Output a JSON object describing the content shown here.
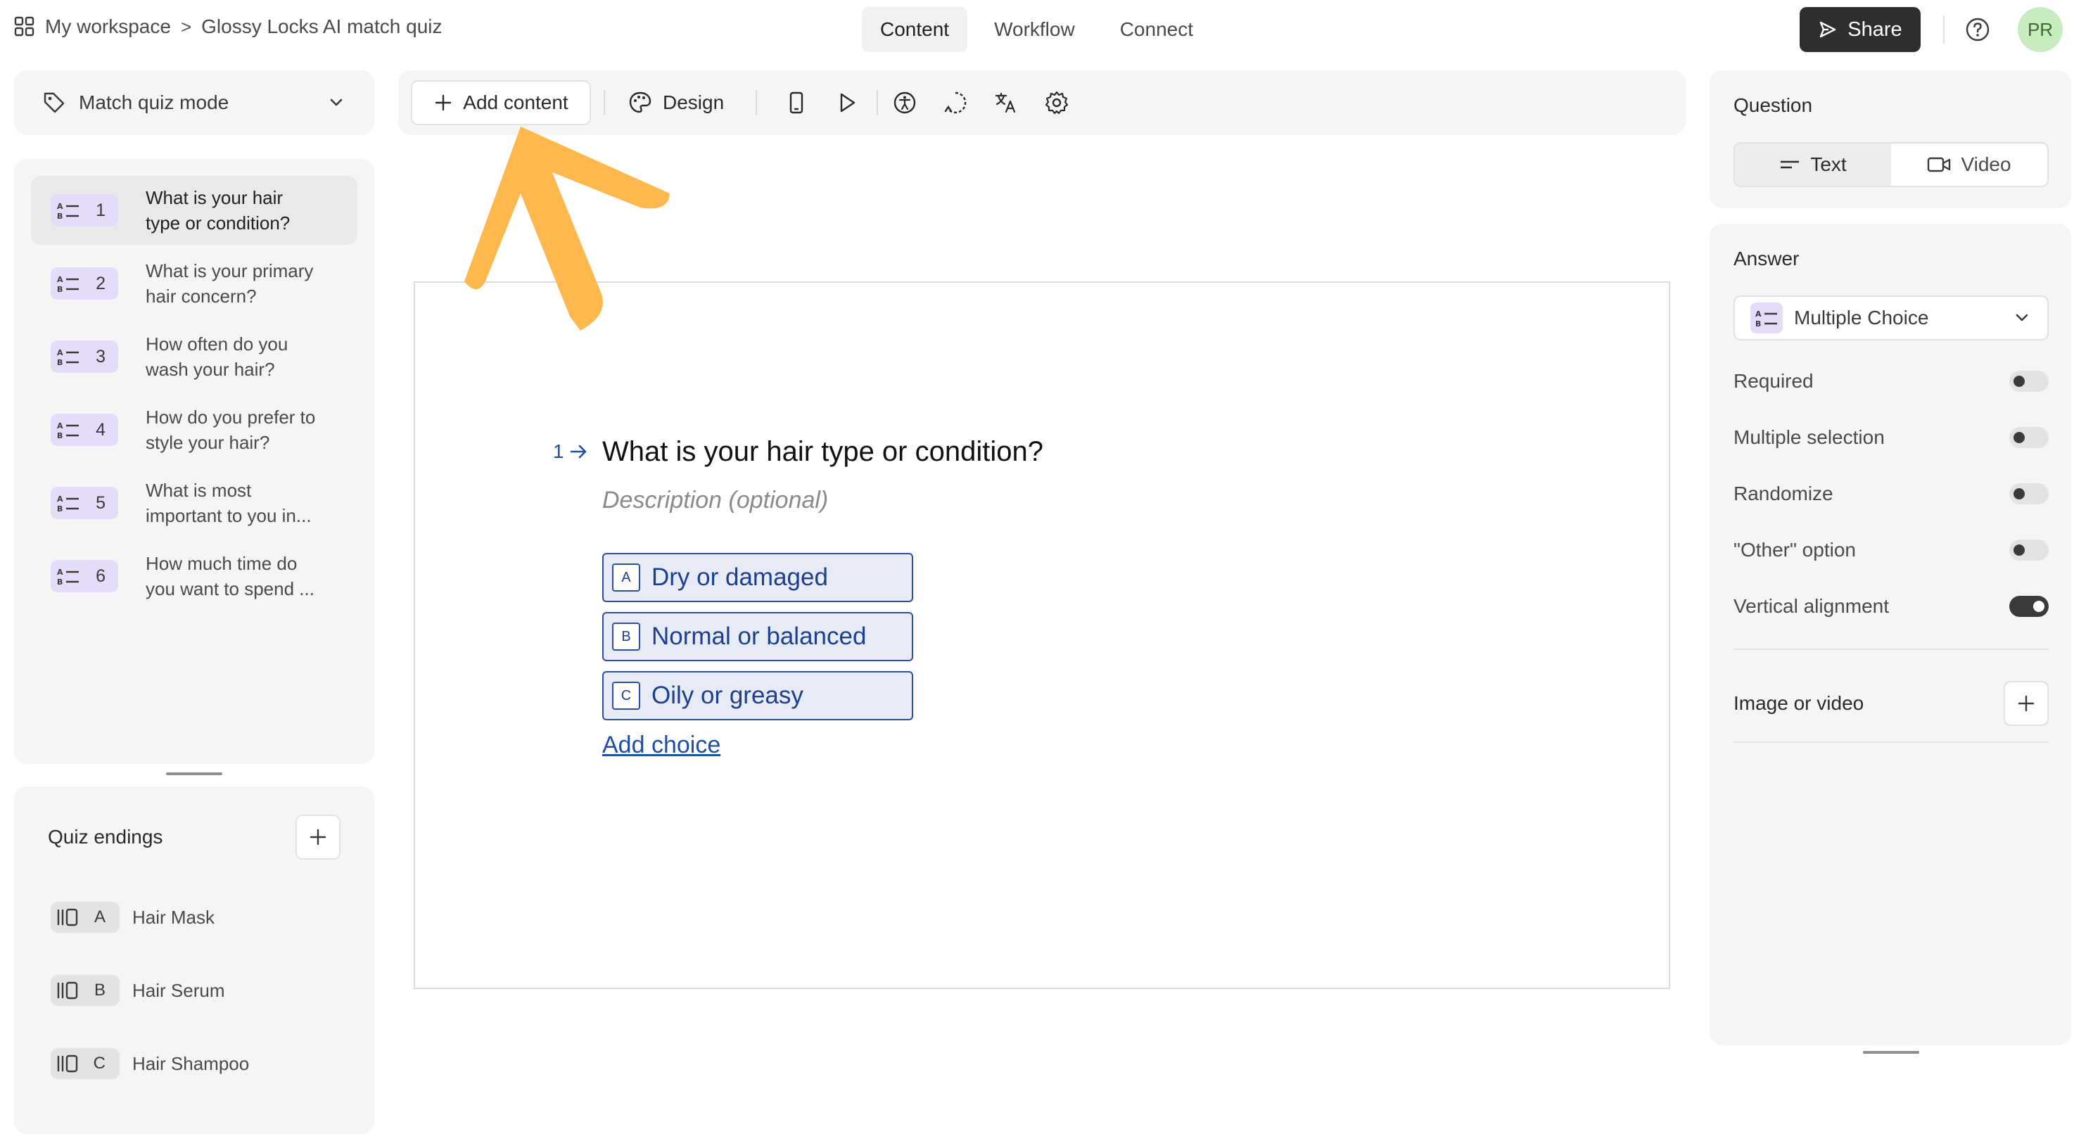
{
  "breadcrumb": {
    "workspace": "My workspace",
    "separator": ">",
    "form_name": "Glossy Locks AI match quiz"
  },
  "nav": {
    "tabs": [
      {
        "label": "Content"
      },
      {
        "label": "Workflow"
      },
      {
        "label": "Connect"
      }
    ]
  },
  "header": {
    "share_label": "Share",
    "avatar_initials": "PR"
  },
  "mode_select": {
    "label": "Match quiz mode"
  },
  "questions": [
    {
      "num": "1",
      "line1": "What is your hair",
      "line2": "type or condition?"
    },
    {
      "num": "2",
      "line1": "What is your primary",
      "line2": "hair concern?"
    },
    {
      "num": "3",
      "line1": "How often do you",
      "line2": "wash your hair?"
    },
    {
      "num": "4",
      "line1": "How do you prefer to",
      "line2": "style your hair?"
    },
    {
      "num": "5",
      "line1": "What is most",
      "line2": "important to you in..."
    },
    {
      "num": "6",
      "line1": "How much time do",
      "line2": "you want to spend ..."
    }
  ],
  "endings": {
    "title": "Quiz endings",
    "items": [
      {
        "key": "A",
        "label": "Hair Mask"
      },
      {
        "key": "B",
        "label": "Hair Serum"
      },
      {
        "key": "C",
        "label": "Hair Shampoo"
      }
    ]
  },
  "toolbar": {
    "add_content_label": "Add content",
    "design_label": "Design"
  },
  "canvas": {
    "question_number": "1",
    "question_title": "What is your hair type or condition?",
    "description_placeholder": "Description (optional)",
    "choices": [
      {
        "key": "A",
        "label": "Dry or damaged"
      },
      {
        "key": "B",
        "label": "Normal or balanced"
      },
      {
        "key": "C",
        "label": "Oily or greasy"
      }
    ],
    "add_choice_label": "Add choice"
  },
  "right_panel": {
    "question_title": "Question",
    "question_types": [
      {
        "label": "Text"
      },
      {
        "label": "Video"
      }
    ],
    "answer_title": "Answer",
    "answer_type": "Multiple Choice",
    "settings": [
      {
        "label": "Required",
        "on": false
      },
      {
        "label": "Multiple selection",
        "on": false
      },
      {
        "label": "Randomize",
        "on": false
      },
      {
        "label": "\"Other\" option",
        "on": false
      },
      {
        "label": "Vertical alignment",
        "on": true
      }
    ],
    "media_label": "Image or video"
  },
  "colors": {
    "accent_arrow": "#FFB84D",
    "choice_blue": "#2B4FA4",
    "share_bg": "#2E2E2E",
    "avatar_bg": "#C8ECC0"
  }
}
